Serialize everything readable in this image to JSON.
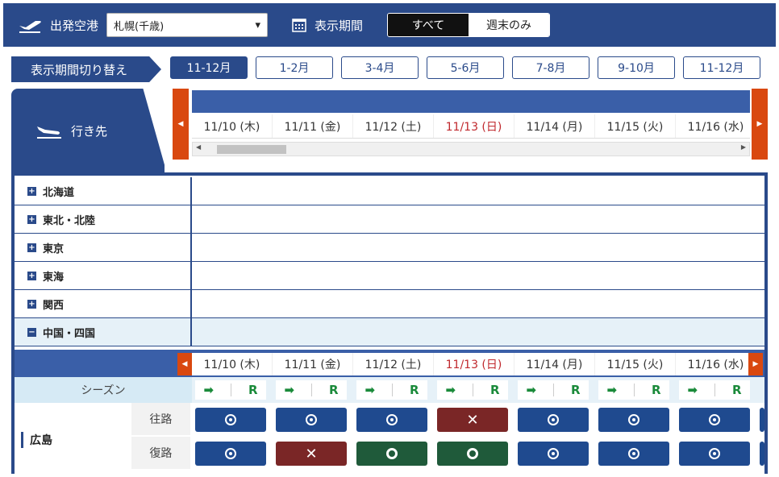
{
  "header": {
    "airport_label": "出発空港",
    "airport_value": "札幌(千歳)",
    "period_label": "表示期間",
    "period_all": "すべて",
    "period_weekend": "週末のみ"
  },
  "period_switch": {
    "label": "表示期間切り替え",
    "tabs": [
      "11-12月",
      "1-2月",
      "3-4月",
      "5-6月",
      "7-8月",
      "9-10月",
      "11-12月"
    ],
    "active_index": 0
  },
  "dest": {
    "label": "行き先"
  },
  "dates": [
    "11/10 (木)",
    "11/11 (金)",
    "11/12 (土)",
    "11/13 (日)",
    "11/14 (月)",
    "11/15 (火)",
    "11/16 (水)"
  ],
  "regions": [
    "北海道",
    "東北・北陸",
    "東京",
    "東海",
    "関西",
    "中国・四国"
  ],
  "season": {
    "label": "シーズン",
    "arrow": "➡",
    "r": "R"
  },
  "city": {
    "name": "広島",
    "outbound_label": "往路",
    "return_label": "復路",
    "outbound": [
      "avail",
      "avail",
      "avail",
      "none",
      "avail",
      "avail",
      "avail"
    ],
    "return": [
      "avail",
      "none",
      "ok",
      "ok",
      "avail",
      "avail",
      "avail"
    ]
  },
  "colors": {
    "primary": "#2a4a8a",
    "accent": "#d9480f",
    "sunday": "#c0282d"
  }
}
